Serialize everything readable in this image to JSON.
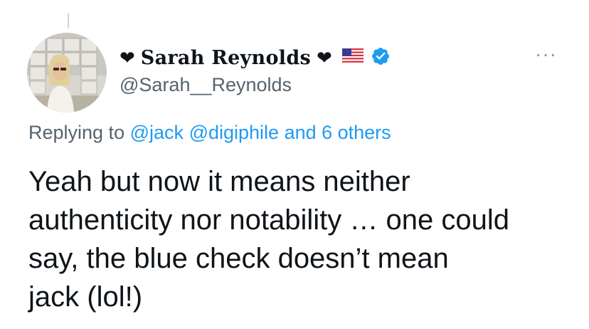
{
  "tweet": {
    "display_name": "Sarah Reynolds",
    "heart_glyph": "❤",
    "handle": "@Sarah__Reynolds",
    "more_glyph": "···",
    "verified_icon": "verified-badge-icon",
    "flag_icon": "us-flag-icon",
    "reply": {
      "prefix": "Replying to",
      "mention1": "@jack",
      "mention2": "@digiphile",
      "others": "and 6 others"
    },
    "text_lines": [
      "Yeah but now it means neither",
      "authenticity nor notability … one could",
      "say, the blue check doesn’t mean",
      "jack (lol!)"
    ]
  },
  "colors": {
    "text": "#0f1419",
    "secondary": "#536471",
    "link": "#1d9bf0",
    "verified": "#1d9bf0"
  }
}
